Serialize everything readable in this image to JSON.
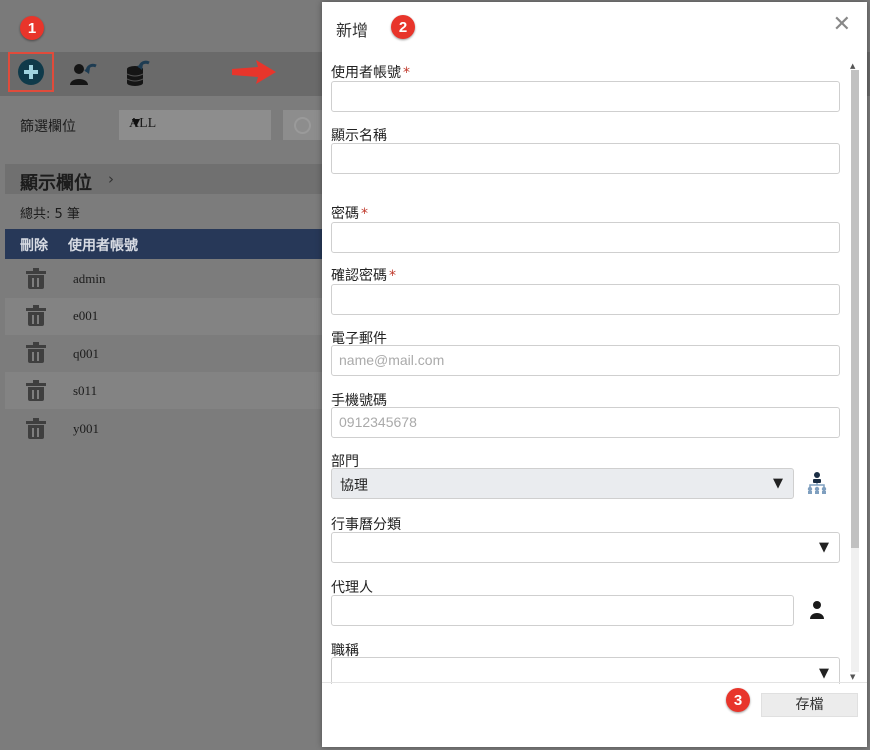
{
  "markers": {
    "one": "1",
    "two": "2",
    "three": "3"
  },
  "background": {
    "filter_label": "篩選欄位",
    "filter_value": "ALL",
    "section_title": "顯示欄位",
    "total_text": "總共: 5 筆",
    "table_headers": [
      "刪除",
      "使用者帳號"
    ],
    "rows": [
      "admin",
      "e001",
      "q001",
      "s011",
      "y001"
    ]
  },
  "dialog": {
    "title": "新增",
    "close": "✕",
    "fields": {
      "account_label": "使用者帳號",
      "display_name_label": "顯示名稱",
      "password_label": "密碼",
      "confirm_password_label": "確認密碼",
      "email_label": "電子郵件",
      "email_placeholder": "name@mail.com",
      "mobile_label": "手機號碼",
      "mobile_placeholder": "0912345678",
      "department_label": "部門",
      "department_value": "協理",
      "calendar_category_label": "行事曆分類",
      "agent_label": "代理人",
      "job_title_label": "職稱"
    },
    "required_mark": "*",
    "save_label": "存檔"
  },
  "colors": {
    "badge": "#e8352b",
    "table_header": "#273858",
    "add_button_border": "#e04b3b"
  }
}
